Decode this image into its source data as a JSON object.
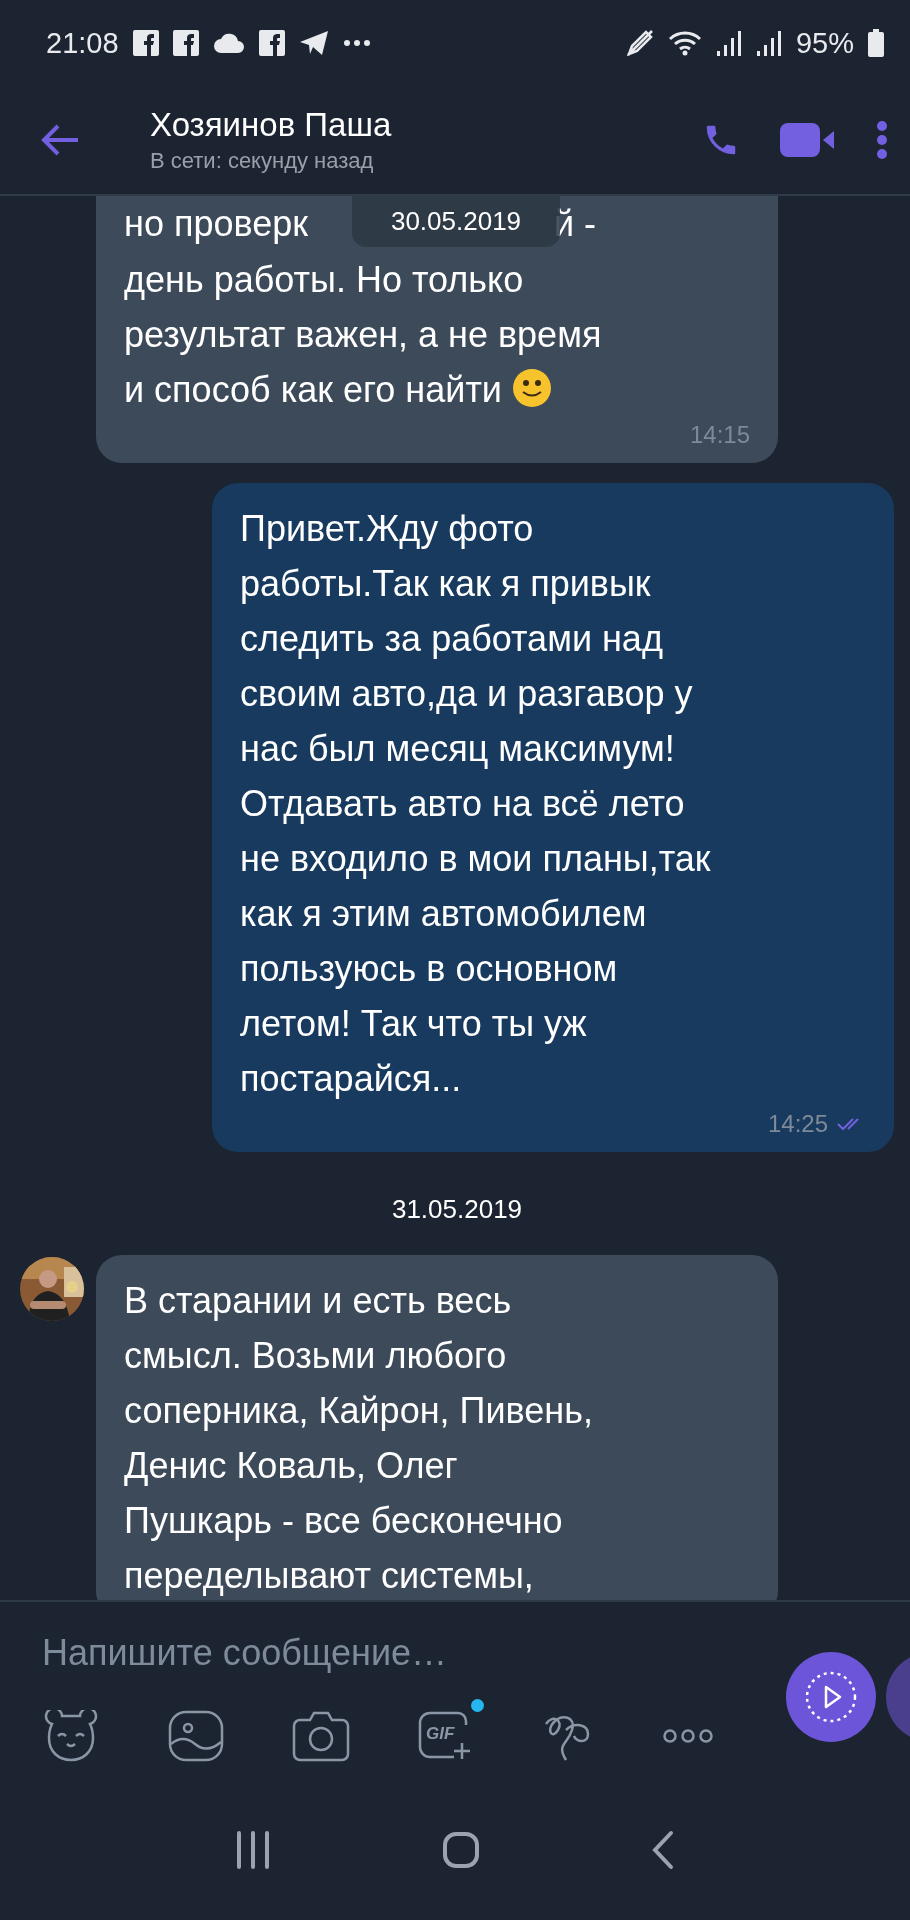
{
  "status_bar": {
    "time": "21:08",
    "battery": "95%"
  },
  "header": {
    "title": "Хозяинов Паша",
    "subtitle": "В сети: секунду назад"
  },
  "sticky_date": "30.05.2019",
  "messages": [
    {
      "kind": "received",
      "partial_line": [
        "но проверк",
        "й -"
      ],
      "text": "день работы. Но только\nрезультат важен, а не время\nи способ как его найти",
      "emoji": true,
      "time": "14:15",
      "avatar": false,
      "cut_top": true
    },
    {
      "kind": "sent",
      "text": "Привет.Жду фото\nработы.Так как я привык\nследить за работами над\nсвоим авто,да и разгавор у\nнас был месяц максимум!\nОтдавать авто на всё лето\nне входило в мои планы,так\nкак я этим автомобилем\nпользуюсь в основном\nлетом! Так что ты уж\nпостарайся...",
      "time": "14:25",
      "read": true
    },
    {
      "kind": "date",
      "text": "31.05.2019"
    },
    {
      "kind": "received",
      "text": "В старании и есть весь\nсмысл. Возьми любого\nсоперника, Кайрон, Пивень,\nДенис Коваль, Олег\nПушкарь - все бесконечно\nпеределывают системы,",
      "avatar": true
    }
  ],
  "composer": {
    "placeholder": "Напишите сообщение…",
    "gif_label": "GIF",
    "gif_new": true
  }
}
